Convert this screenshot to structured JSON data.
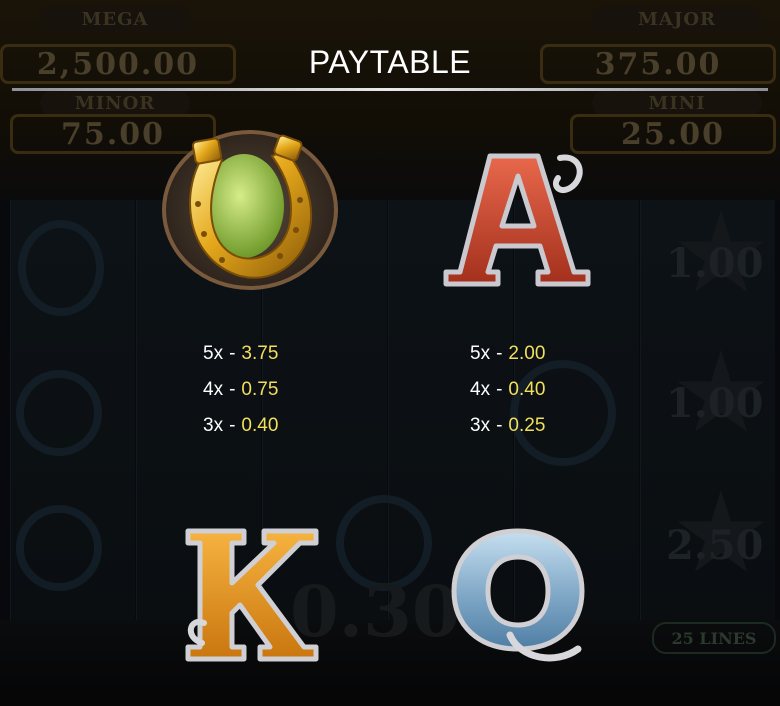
{
  "background": {
    "jackpots": [
      {
        "label": "MEGA",
        "value": "2,500.00"
      },
      {
        "label": "MAJOR",
        "value": "375.00"
      },
      {
        "label": "MINOR",
        "value": "75.00"
      },
      {
        "label": "MINI",
        "value": "25.00"
      }
    ],
    "reel_values": [
      "1.00",
      "1.00",
      "2.50"
    ],
    "bet_value": "0.30",
    "lines": "25 LINES"
  },
  "paytable": {
    "title": "PAYTABLE",
    "symbols": [
      {
        "name": "horseshoe",
        "icon": "horseshoe-icon",
        "payouts": [
          {
            "count": "5x",
            "sep": "-",
            "value": "3.75"
          },
          {
            "count": "4x",
            "sep": "-",
            "value": "0.75"
          },
          {
            "count": "3x",
            "sep": "-",
            "value": "0.40"
          }
        ]
      },
      {
        "name": "A",
        "icon": "letter-a-icon",
        "payouts": [
          {
            "count": "5x",
            "sep": "-",
            "value": "2.00"
          },
          {
            "count": "4x",
            "sep": "-",
            "value": "0.40"
          },
          {
            "count": "3x",
            "sep": "-",
            "value": "0.25"
          }
        ]
      },
      {
        "name": "K",
        "icon": "letter-k-icon"
      },
      {
        "name": "Q",
        "icon": "letter-q-icon"
      }
    ]
  },
  "colors": {
    "payout_value": "#f2df5a",
    "payout_count": "#ffffff",
    "title": "#ffffff"
  }
}
